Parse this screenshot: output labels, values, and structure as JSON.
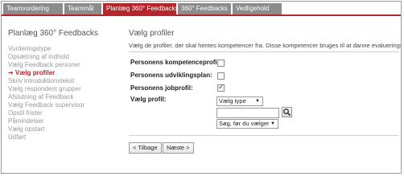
{
  "tabs": [
    {
      "label": "Teamvurdering"
    },
    {
      "label": "Teammål"
    },
    {
      "label": "Planlæg 360° Feedbacks",
      "active": true
    },
    {
      "label": "360° Feedbacks"
    },
    {
      "label": "Vedligehold"
    }
  ],
  "sidebar": {
    "title": "Planlæg 360° Feedbacks",
    "items": [
      {
        "label": "Vurderingstype"
      },
      {
        "label": "Opsætning af indhold"
      },
      {
        "label": "Vælg Feedback personer"
      },
      {
        "label": "➔ Vælg profiler",
        "active": true
      },
      {
        "label": "Skriv introduktionstekst"
      },
      {
        "label": "Vælg respondent grupper"
      },
      {
        "label": "Afslutning af Feedback"
      },
      {
        "label": "Vælg Feedback supervisor"
      },
      {
        "label": "Opstil frister"
      },
      {
        "label": "Påmindelser"
      },
      {
        "label": "Vælg opstart"
      },
      {
        "label": "Udført"
      }
    ]
  },
  "main": {
    "title": "Vælg profiler",
    "description": "Vælg de profiler, der skal hentes kompetencer fra. Disse kompetencer bruges til at danne evalueringsskemaet",
    "fields": {
      "kompetenceprofil_label": "Personens kompetenceprofil:",
      "kompetenceprofil_checked": false,
      "udviklingsplan_label": "Personens udviklingsplan:",
      "udviklingsplan_checked": false,
      "jobprofil_label": "Personens jobprofil:",
      "jobprofil_checked": true,
      "vaelg_profil_label": "Vælg profil:",
      "type_select_value": "Vælg type",
      "search_input_value": "",
      "search_select_value": "Søg, før du vælger"
    },
    "buttons": {
      "back": "< Tilbage",
      "next": "Næste >"
    }
  },
  "colors": {
    "accent": "#b3262b",
    "tab_inactive": "#8c8c8c",
    "sidebar_text": "#999999"
  }
}
